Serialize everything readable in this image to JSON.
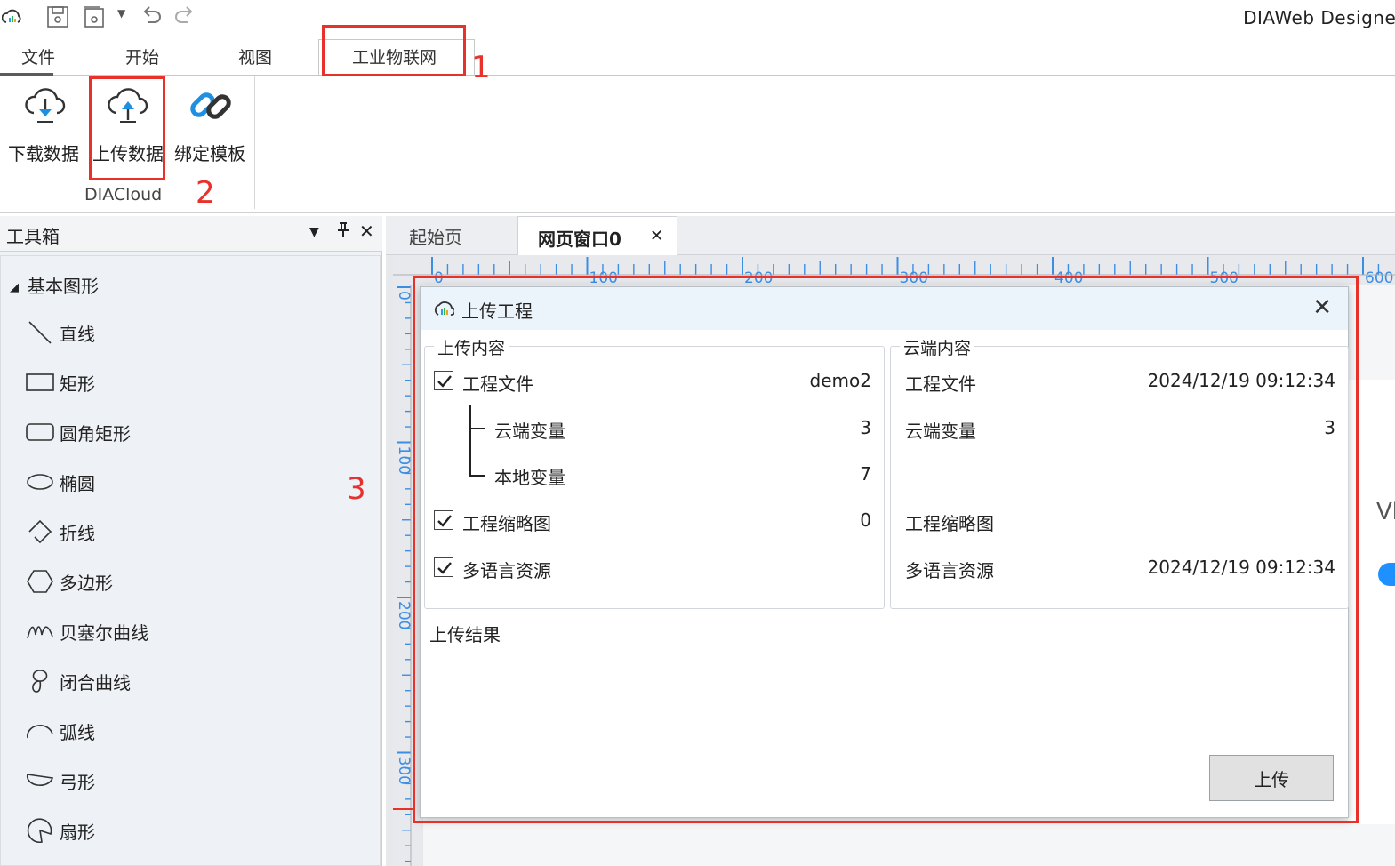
{
  "app": {
    "title": "DIAWeb Designer"
  },
  "ribbon": {
    "tabs": [
      {
        "label": "文件"
      },
      {
        "label": "开始"
      },
      {
        "label": "视图"
      },
      {
        "label": "工业物联网"
      }
    ],
    "buttons": [
      {
        "label": "下载数据",
        "icon": "cloud-download-icon"
      },
      {
        "label": "上传数据",
        "icon": "cloud-upload-icon"
      },
      {
        "label": "绑定模板",
        "icon": "link-icon"
      }
    ],
    "group_label": "DIACloud"
  },
  "toolbox": {
    "title": "工具箱",
    "category": "基本图形",
    "items": [
      {
        "label": "直线",
        "icon": "line-icon"
      },
      {
        "label": "矩形",
        "icon": "rectangle-icon"
      },
      {
        "label": "圆角矩形",
        "icon": "rounded-rectangle-icon"
      },
      {
        "label": "椭圆",
        "icon": "ellipse-icon"
      },
      {
        "label": "折线",
        "icon": "polyline-icon"
      },
      {
        "label": "多边形",
        "icon": "polygon-icon"
      },
      {
        "label": "贝塞尔曲线",
        "icon": "bezier-icon"
      },
      {
        "label": "闭合曲线",
        "icon": "closed-curve-icon"
      },
      {
        "label": "弧线",
        "icon": "arc-icon"
      },
      {
        "label": "弓形",
        "icon": "segment-icon"
      },
      {
        "label": "扇形",
        "icon": "sector-icon"
      }
    ]
  },
  "doc_tabs": [
    {
      "label": "起始页"
    },
    {
      "label": "网页窗口0"
    }
  ],
  "ruler": {
    "h_labels": [
      "0",
      "100",
      "200",
      "300",
      "400",
      "500",
      "600"
    ],
    "v_labels": [
      "0",
      "100",
      "200",
      "300"
    ]
  },
  "canvas_fragment": "Vh",
  "dialog": {
    "title": "上传工程",
    "upload_section": {
      "legend": "上传内容",
      "rows": [
        {
          "label": "工程文件",
          "value": "demo2",
          "checked": true
        },
        {
          "label": "云端变量",
          "value": "3"
        },
        {
          "label": "本地变量",
          "value": "7"
        },
        {
          "label": "工程缩略图",
          "value": "0",
          "checked": true
        },
        {
          "label": "多语言资源",
          "value": "",
          "checked": true
        }
      ]
    },
    "cloud_section": {
      "legend": "云端内容",
      "rows": [
        {
          "label": "工程文件",
          "value": "2024/12/19 09:12:34"
        },
        {
          "label": "云端变量",
          "value": "3"
        },
        {
          "label": "工程缩略图",
          "value": ""
        },
        {
          "label": "多语言资源",
          "value": "2024/12/19 09:12:34"
        }
      ]
    },
    "result_label": "上传结果",
    "upload_button": "上传"
  },
  "annotations": [
    "1",
    "2",
    "3"
  ],
  "colors": {
    "annotation_red": "#e8312b",
    "accent_blue": "#1e90ff",
    "ruler_blue": "#3a8ee6"
  }
}
